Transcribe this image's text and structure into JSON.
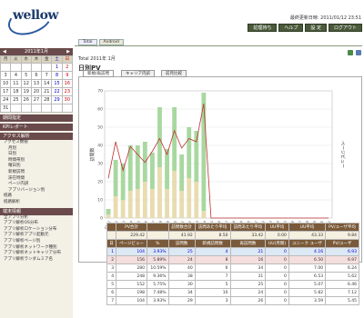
{
  "header": {
    "logo": "wellow",
    "logo_sub": "",
    "updated": "最終更新日時: 2011/01/12 23:51",
    "buttons": [
      "処理待ち",
      "ヘルプ",
      "設 定",
      "ログアウト"
    ]
  },
  "tabs": [
    "Total",
    "Android"
  ],
  "calendar": {
    "title": "2011年1月",
    "dow": [
      "月",
      "火",
      "水",
      "木",
      "金",
      "土",
      "日"
    ],
    "weeks": [
      [
        "",
        "",
        "",
        "",
        "",
        "1",
        "2"
      ],
      [
        "3",
        "4",
        "5",
        "6",
        "7",
        "8",
        "9"
      ],
      [
        "10",
        "11",
        "12",
        "13",
        "14",
        "15",
        "16"
      ],
      [
        "17",
        "18",
        "19",
        "20",
        "21",
        "22",
        "23"
      ],
      [
        "24",
        "25",
        "26",
        "27",
        "28",
        "29",
        "30"
      ],
      [
        "31",
        "",
        "",
        "",
        "",
        "",
        ""
      ]
    ]
  },
  "sidebar": {
    "sections": [
      {
        "title": "期間指定",
        "items": []
      },
      {
        "title": "KPIレポート",
        "items": []
      },
      {
        "title": "アクセス解析",
        "items": [
          "アクセス数値",
          "月別",
          "日別",
          "時間帯別",
          "曜日別",
          "新規訪問",
          "滞在時間",
          "ページ内訳",
          "アプリバージョン別"
        ]
      },
      {
        "title": "",
        "items": [
          "経路",
          "経路解析"
        ]
      },
      {
        "title": "端末情報",
        "items": [
          "全アプリ分析",
          "アプリ解析OS分布",
          "アプリ解析ロケーション分布",
          "アプリ解析アプリ起動元",
          "アプリ解析ページ別",
          "アプリ解析ネットワーク種別",
          "アプリ解析ネットキャリア分布",
          "アプリ解析ランダムミア名"
        ]
      }
    ]
  },
  "main": {
    "total": "Total 2011年 1月",
    "title": "日別PV",
    "chart_tabs": [
      "新規/再訪問",
      "キャリア内訳",
      "前月比較"
    ]
  },
  "chart_data": {
    "type": "bar",
    "ylim": [
      0,
      70
    ],
    "ylabel": "訪問数",
    "y2label": "ページビュー",
    "legend": [
      "新規訪問数",
      "再訪問数",
      "ページビュー"
    ],
    "new": [
      3,
      20,
      20,
      25,
      24,
      22,
      20,
      33,
      22,
      35,
      20,
      28,
      28,
      65,
      0,
      0,
      0,
      0,
      0,
      0,
      0,
      0,
      0,
      0,
      0,
      0,
      0,
      0,
      0,
      0,
      0
    ],
    "returning": [
      2,
      12,
      10,
      15,
      16,
      20,
      16,
      28,
      16,
      26,
      15,
      22,
      20,
      4,
      0,
      0,
      0,
      0,
      0,
      0,
      0,
      0,
      0,
      0,
      0,
      0,
      0,
      0,
      0,
      0,
      0
    ],
    "pv": [
      25,
      48,
      30,
      45,
      40,
      35,
      42,
      50,
      40,
      55,
      44,
      50,
      48,
      72,
      0,
      0,
      0,
      0,
      0,
      0,
      0,
      0,
      0,
      0,
      0,
      0,
      0,
      0,
      0,
      0,
      0
    ]
  },
  "stats": {
    "header1": [
      "",
      "PV合計",
      "",
      "訪問数合計",
      "訪問あたり平均",
      "訪問あたり平均",
      "UU平均",
      "UU平均",
      "PV/ユーザ平均"
    ],
    "sum": [
      "",
      "229.42",
      "",
      "41.92",
      "8.50",
      "33.42",
      "0.00",
      "43.33",
      "9.84"
    ],
    "header2": [
      "日",
      "ページビュー",
      "%",
      "訪問数",
      "新規訪問数",
      "再訪問数",
      "UU(月間)",
      "ユニーク ユーザ",
      "PV/ユーザ"
    ],
    "rows": [
      [
        "1",
        "104",
        "3.93%",
        "25",
        "4",
        "21",
        "0",
        "4.16",
        "6.93"
      ],
      [
        "2",
        "156",
        "5.89%",
        "24",
        "8",
        "16",
        "0",
        "6.50",
        "6.97"
      ],
      [
        "3",
        "280",
        "10.59%",
        "40",
        "6",
        "34",
        "0",
        "7.00",
        "6.24"
      ],
      [
        "4",
        "248",
        "9.36%",
        "38",
        "7",
        "31",
        "0",
        "6.53",
        "5.62"
      ],
      [
        "5",
        "152",
        "5.75%",
        "30",
        "5",
        "25",
        "0",
        "5.07",
        "6.46"
      ],
      [
        "6",
        "198",
        "7.48%",
        "34",
        "10",
        "24",
        "0",
        "5.82",
        "7.12"
      ],
      [
        "7",
        "104",
        "3.93%",
        "29",
        "3",
        "26",
        "0",
        "3.59",
        "5.45"
      ]
    ]
  }
}
